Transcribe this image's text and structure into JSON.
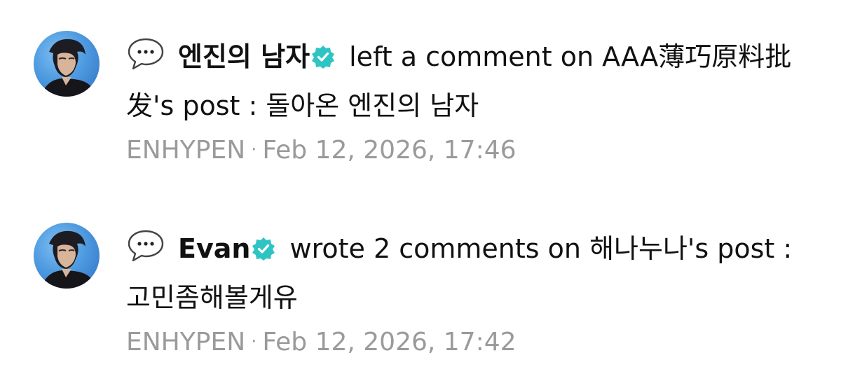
{
  "notifications": [
    {
      "icon": "speech-bubble-icon",
      "username": "엔진의 남자",
      "verified": true,
      "action_text": " left a comment on AAA薄巧原料批发's post : 돌아온 엔진의 남자",
      "community": "ENHYPEN",
      "separator": "·",
      "timestamp": "Feb 12, 2026, 17:46"
    },
    {
      "icon": "speech-bubble-icon",
      "username": "Evan",
      "verified": true,
      "action_text": " wrote 2 comments on 해나누나's post : 고민좀해볼게유",
      "community": "ENHYPEN",
      "separator": "·",
      "timestamp": "Feb 12, 2026, 17:42"
    }
  ],
  "colors": {
    "text": "#111111",
    "meta": "#9a9a9a",
    "verified": "#2ec4c4",
    "avatar_bg": "#4f9be0"
  }
}
